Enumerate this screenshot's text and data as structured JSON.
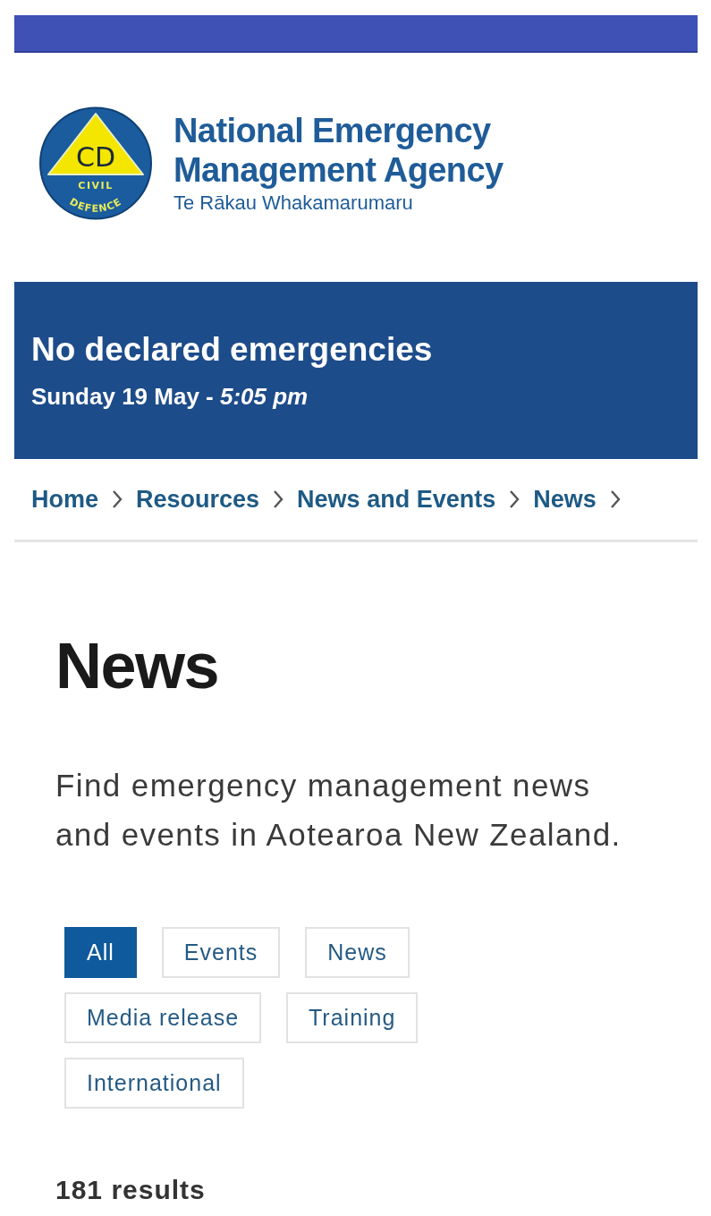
{
  "header": {
    "logo": {
      "initials": "CD",
      "upper_text": "CIVIL",
      "lower_text": "DEFENCE"
    },
    "title": "National Emergency Management Agency",
    "subtitle": "Te Rākau Whakamarumaru"
  },
  "alert_banner": {
    "title": "No declared emergencies",
    "date": "Sunday 19 May - *5:05 pm*"
  },
  "breadcrumbs": [
    "Home",
    "Resources",
    "News and Events",
    "News"
  ],
  "page": {
    "heading": "News",
    "description": "Find emergency management news and events in Aotearoa New Zealand."
  },
  "filters": [
    {
      "label": "All",
      "selected": true
    },
    {
      "label": "Events",
      "selected": false
    },
    {
      "label": "News",
      "selected": false
    },
    {
      "label": "Media release",
      "selected": false
    },
    {
      "label": "Training",
      "selected": false
    },
    {
      "label": "International",
      "selected": false
    }
  ],
  "results_count": "181 results"
}
